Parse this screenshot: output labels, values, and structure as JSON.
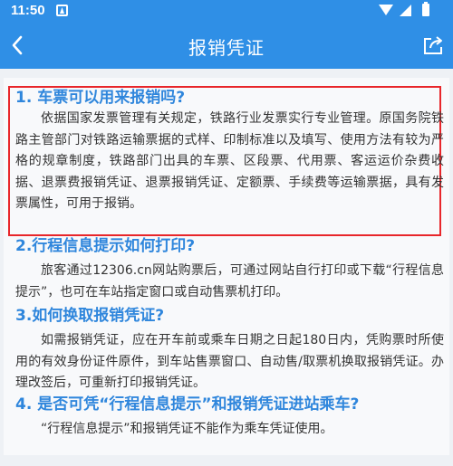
{
  "status_bar": {
    "time": "11:50",
    "app_icon": "notification-a-icon",
    "icons": [
      "wifi-icon",
      "signal-icon",
      "battery-icon"
    ]
  },
  "app_bar": {
    "title": "报销凭证",
    "back_icon": "back-arrow-icon",
    "share_icon": "share-icon",
    "color": "#2f8fe6"
  },
  "faq": [
    {
      "question": "1. 车票可以用来报销吗?",
      "answer": "依据国家发票管理有关规定，铁路行业发票实行专业管理。原国务院铁路主管部门对铁路运输票据的式样、印制标准以及填写、使用方法有较为严格的规章制度，铁路部门出具的车票、区段票、代用票、客运运价杂费收据、退票费报销凭证、退票报销凭证、定额票、手续费等运输票据，具有发票属性，可用于报销。",
      "highlighted": true
    },
    {
      "question": "2.行程信息提示如何打印?",
      "answer": "旅客通过12306.cn网站购票后，可通过网站自行打印或下载“行程信息提示”，也可在车站指定窗口或自动售票机打印。"
    },
    {
      "question": "3.如何换取报销凭证?",
      "answer": "如需报销凭证，应在开车前或乘车日期之日起180日内，凭购票时所使用的有效身份证件原件，到车站售票窗口、自动售/取票机换取报销凭证。办理改签后，可重新打印报销凭证。"
    },
    {
      "question": "4. 是否可凭“行程信息提示”和报销凭证进站乘车?",
      "answer": "“行程信息提示”和报销凭证不能作为乘车凭证使用。"
    }
  ],
  "colors": {
    "question_text": "#2f86dc",
    "highlight_border": "#e8262a",
    "answer_text": "#333333"
  }
}
